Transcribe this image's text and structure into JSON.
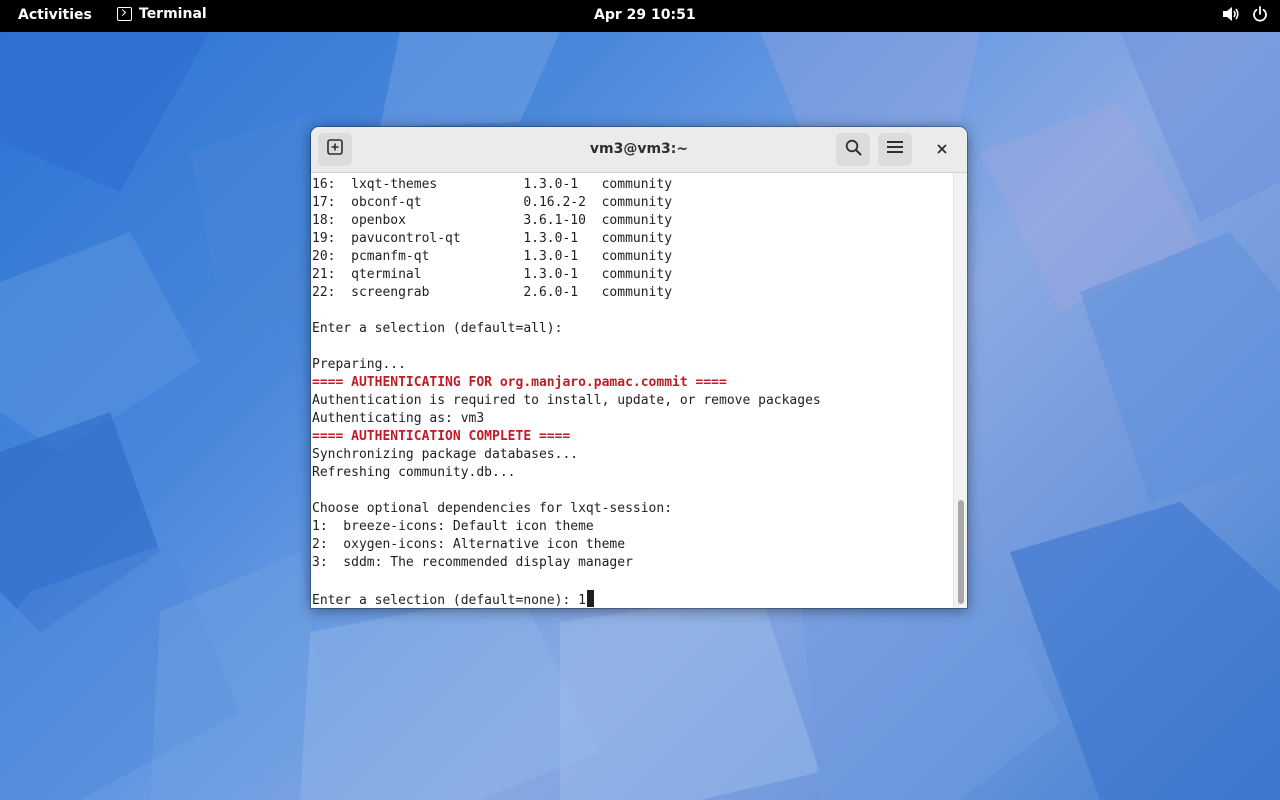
{
  "topbar": {
    "activities": "Activities",
    "app_name": "Terminal",
    "clock": "Apr 29  10:51",
    "icons": [
      "terminal-icon",
      "volume-icon",
      "power-icon"
    ]
  },
  "window": {
    "title": "vm3@vm3:~",
    "buttons": [
      "new-tab-icon",
      "search-icon",
      "hamburger-menu-icon",
      "close-icon"
    ]
  },
  "terminal": {
    "lines": [
      {
        "text": "16:  lxqt-themes           1.3.0-1   community",
        "style": "normal"
      },
      {
        "text": "17:  obconf-qt             0.16.2-2  community",
        "style": "normal"
      },
      {
        "text": "18:  openbox               3.6.1-10  community",
        "style": "normal"
      },
      {
        "text": "19:  pavucontrol-qt        1.3.0-1   community",
        "style": "normal"
      },
      {
        "text": "20:  pcmanfm-qt            1.3.0-1   community",
        "style": "normal"
      },
      {
        "text": "21:  qterminal             1.3.0-1   community",
        "style": "normal"
      },
      {
        "text": "22:  screengrab            2.6.0-1   community",
        "style": "normal"
      },
      {
        "text": "",
        "style": "normal"
      },
      {
        "text": "Enter a selection (default=all):",
        "style": "normal"
      },
      {
        "text": "",
        "style": "normal"
      },
      {
        "text": "Preparing...",
        "style": "normal"
      },
      {
        "text": "==== AUTHENTICATING FOR org.manjaro.pamac.commit ====",
        "style": "red"
      },
      {
        "text": "Authentication is required to install, update, or remove packages",
        "style": "normal"
      },
      {
        "text": "Authenticating as: vm3",
        "style": "normal"
      },
      {
        "text": "==== AUTHENTICATION COMPLETE ====",
        "style": "red"
      },
      {
        "text": "Synchronizing package databases...",
        "style": "normal"
      },
      {
        "text": "Refreshing community.db...",
        "style": "normal"
      },
      {
        "text": "",
        "style": "normal"
      },
      {
        "text": "Choose optional dependencies for lxqt-session:",
        "style": "normal"
      },
      {
        "text": "1:  breeze-icons: Default icon theme",
        "style": "normal"
      },
      {
        "text": "2:  oxygen-icons: Alternative icon theme",
        "style": "normal"
      },
      {
        "text": "3:  sddm: The recommended display manager",
        "style": "normal"
      },
      {
        "text": "",
        "style": "normal"
      }
    ],
    "prompt": "Enter a selection (default=none): ",
    "input_value": "1"
  }
}
